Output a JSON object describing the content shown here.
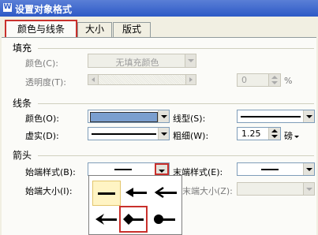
{
  "dialog": {
    "title": "设置对象格式",
    "app_icon": "W"
  },
  "tabs": [
    {
      "label": "颜色与线条",
      "active": true
    },
    {
      "label": "大小",
      "active": false
    },
    {
      "label": "版式",
      "active": false
    }
  ],
  "fill": {
    "section": "填充",
    "color_label": "颜色(C):",
    "color_value": "无填充颜色",
    "transparency_label": "透明度(T):",
    "transparency_value": "0",
    "transparency_unit": "%"
  },
  "line": {
    "section": "线条",
    "color_label": "颜色(O):",
    "color_swatch": "#7b9fcf",
    "style_label": "线型(S):",
    "dash_label": "虚实(D):",
    "weight_label": "粗细(W):",
    "weight_value": "1.25",
    "weight_unit": "磅"
  },
  "arrows": {
    "section": "箭头",
    "begin_style_label": "始端样式(B):",
    "end_style_label": "末端样式(E):",
    "begin_size_label": "始端大小(I):",
    "end_size_label": "末端大小(Z):"
  },
  "arrow_popup": {
    "options": [
      {
        "icon": "arrow-none-icon",
        "selected": true,
        "current": false
      },
      {
        "icon": "arrow-triangle-icon",
        "selected": false,
        "current": false
      },
      {
        "icon": "arrow-open-icon",
        "selected": false,
        "current": false
      },
      {
        "icon": "arrow-stealth-icon",
        "selected": false,
        "current": false
      },
      {
        "icon": "arrow-diamond-icon",
        "selected": false,
        "current": true
      },
      {
        "icon": "arrow-oval-icon",
        "selected": false,
        "current": false
      }
    ]
  },
  "colors": {
    "accent_red": "#c9302c",
    "title_blue": "#2d59c6"
  }
}
